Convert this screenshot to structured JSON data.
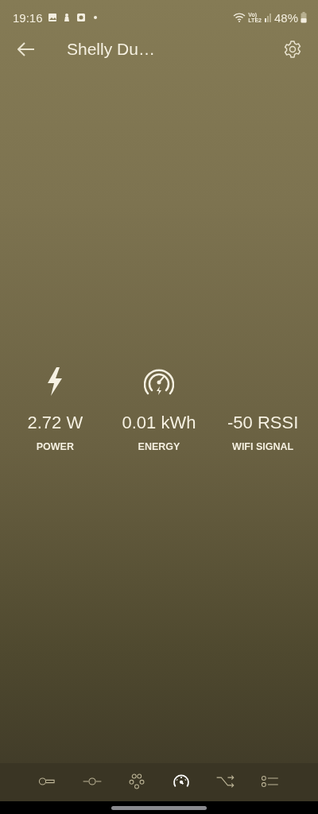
{
  "status_bar": {
    "time": "19:16",
    "notification_icons": [
      {
        "kind": "image"
      },
      {
        "kind": "figure"
      },
      {
        "kind": "camera"
      },
      {
        "kind": "dot"
      }
    ],
    "volte": [
      "Vo)",
      "LTE2"
    ],
    "battery": "48%"
  },
  "header": {
    "title": "Shelly Du…"
  },
  "stats": [
    {
      "kind": "power",
      "value": "2.72 W",
      "label": "POWER"
    },
    {
      "kind": "energy",
      "value": "0.01 kWh",
      "label": "ENERGY"
    },
    {
      "kind": "wifi",
      "value": "-50 RSSI",
      "label": "WIFI SIGNAL"
    }
  ],
  "bottom_nav": [
    {
      "kind": "thermometer",
      "selected": false
    },
    {
      "kind": "slider",
      "selected": false
    },
    {
      "kind": "dots",
      "selected": false
    },
    {
      "kind": "gauge",
      "selected": true
    },
    {
      "kind": "shuffle",
      "selected": false
    },
    {
      "kind": "list",
      "selected": false
    }
  ]
}
